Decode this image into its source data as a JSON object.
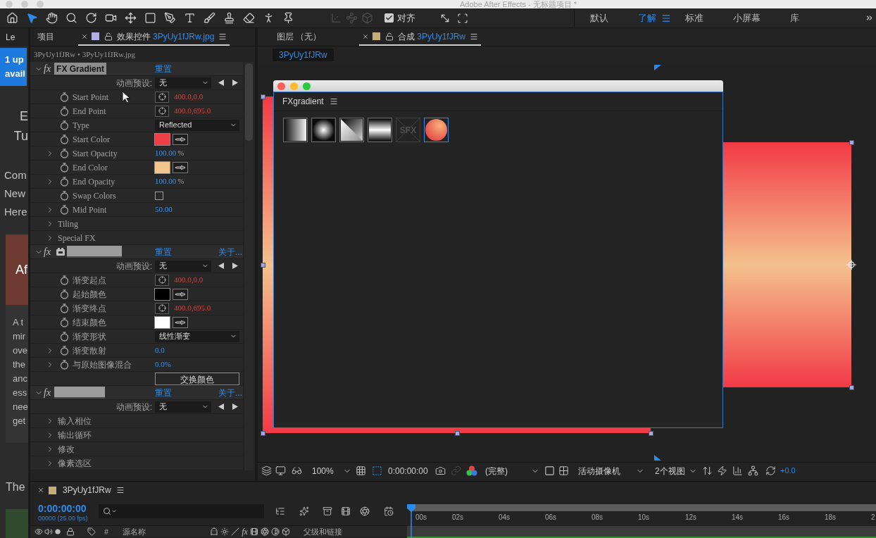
{
  "window": {
    "title": "Adobe After Effects - 无标题项目 *"
  },
  "toolbar": {
    "tool_groups": [
      [
        {
          "kind": "home",
          "selected": false,
          "disabled": false
        },
        {
          "kind": "select",
          "selected": true,
          "disabled": false
        },
        {
          "kind": "hand",
          "selected": false,
          "disabled": false
        },
        {
          "kind": "zoom",
          "selected": false,
          "disabled": false
        },
        {
          "kind": "rotate",
          "selected": false,
          "disabled": false
        },
        {
          "kind": "camera",
          "selected": false,
          "disabled": false
        },
        {
          "kind": "pan_behind",
          "selected": false,
          "disabled": false
        },
        {
          "kind": "rectangle",
          "selected": false,
          "disabled": false
        },
        {
          "kind": "pen",
          "selected": false,
          "disabled": false
        },
        {
          "kind": "type",
          "selected": false,
          "disabled": false
        },
        {
          "kind": "brush",
          "selected": false,
          "disabled": false
        },
        {
          "kind": "stamp",
          "selected": false,
          "disabled": false
        },
        {
          "kind": "eraser",
          "selected": false,
          "disabled": false
        },
        {
          "kind": "roto",
          "selected": false,
          "disabled": false
        },
        {
          "kind": "pin",
          "selected": false,
          "disabled": false
        }
      ],
      [
        {
          "kind": "axis_local",
          "selected": false,
          "disabled": true
        },
        {
          "kind": "axis_world",
          "selected": false,
          "disabled": true
        },
        {
          "kind": "axis_view",
          "selected": false,
          "disabled": true
        }
      ]
    ],
    "snapping": {
      "label": "对齐",
      "checked": true
    },
    "snap_options": [
      {
        "kind": "edges"
      },
      {
        "kind": "frame"
      }
    ]
  },
  "workspaces": [
    {
      "label": "默认",
      "selected": false
    },
    {
      "label": "了解",
      "selected": true
    },
    {
      "label": "标准",
      "selected": false
    },
    {
      "label": "小屏幕",
      "selected": false
    },
    {
      "label": "库",
      "selected": false
    }
  ],
  "background_window": {
    "tab": "Le",
    "notice": [
      "1 up",
      "avail"
    ],
    "heading": [
      "E",
      "Tu"
    ],
    "intro": [
      "Com",
      "New",
      "Here"
    ],
    "card": {
      "caption": "Af",
      "lines": [
        "A t",
        "mir",
        "ove",
        "the",
        "anc",
        "ess",
        "nee",
        "get"
      ]
    },
    "footer": "The"
  },
  "effects_panel": {
    "tabs": [
      {
        "label": "项目",
        "selected": false
      },
      {
        "label": "效果控件",
        "file": "3PyUy1fJRw.jpg",
        "color": "#b6b0e2",
        "selected": true
      }
    ],
    "breadcrumb": "3PyUy1fJRw • 3PyUy1fJRw.jpg",
    "effects": [
      {
        "kind": "titled",
        "name": "FX Gradient",
        "toggle": "fx",
        "expanded": true,
        "reset": "重置",
        "preset_label": "动画预设:",
        "preset": "无",
        "properties": [
          {
            "kind": "point",
            "label": "Start Point",
            "value": "400.0,0.0"
          },
          {
            "kind": "point",
            "label": "End Point",
            "value": "400.0,695.0"
          },
          {
            "kind": "dropdown",
            "label": "Type",
            "value": "Reflected"
          },
          {
            "kind": "color",
            "label": "Start Color",
            "color": "#ef3e45"
          },
          {
            "kind": "number",
            "label": "Start Opacity",
            "value": "100.00",
            "unit": "%",
            "expanded": false
          },
          {
            "kind": "color",
            "label": "End Color",
            "color": "#f2c58f"
          },
          {
            "kind": "number",
            "label": "End Opacity",
            "value": "100.00",
            "unit": "%",
            "expanded": false
          },
          {
            "kind": "checkbox",
            "label": "Swap Colors",
            "checked": false
          },
          {
            "kind": "number",
            "label": "Mid Point",
            "value": "50.00",
            "expanded": false
          },
          {
            "kind": "group",
            "label": "Tiling",
            "expanded": false
          },
          {
            "kind": "group",
            "label": "Special FX",
            "expanded": false
          }
        ]
      },
      {
        "kind": "badged",
        "toggle": "fx",
        "expanded": true,
        "reset": "重置",
        "about": "关于...",
        "preset_label": "动画预设:",
        "preset": "无",
        "properties": [
          {
            "kind": "point",
            "label": "渐变起点",
            "value": "400.0,0.0"
          },
          {
            "kind": "color",
            "label": "起始颜色",
            "color": "#000000"
          },
          {
            "kind": "point",
            "label": "渐变终点",
            "value": "400.0,695.0"
          },
          {
            "kind": "color",
            "label": "结束颜色",
            "color": "#ffffff"
          },
          {
            "kind": "dropdown",
            "label": "渐变形状",
            "value": "线性渐变"
          },
          {
            "kind": "number",
            "label": "渐变散射",
            "value": "0.0",
            "expanded": false
          },
          {
            "kind": "number",
            "label": "与原始图像混合",
            "value": "0.0%",
            "expanded": false
          },
          {
            "kind": "button",
            "label": "交换颜色"
          }
        ]
      },
      {
        "kind": "plain",
        "toggle": "fx",
        "expanded": true,
        "reset": "重置",
        "about": "关于...",
        "preset_label": "动画预设:",
        "preset": "无",
        "properties": [
          {
            "kind": "group",
            "label": "输入相位",
            "expanded": false
          },
          {
            "kind": "group",
            "label": "输出循环",
            "expanded": false
          },
          {
            "kind": "group",
            "label": "修改",
            "expanded": false
          },
          {
            "kind": "group",
            "label": "像素选区",
            "expanded": false
          }
        ]
      }
    ]
  },
  "composition_panel": {
    "tabs": [
      {
        "label": "图层 （无）",
        "selected": false
      },
      {
        "label": "合成",
        "file": "3PyUy1fJRw",
        "color": "#c6ac76",
        "selected": true
      }
    ],
    "view_tabs": [
      {
        "label": "3PyUy1fJRw",
        "selected": true
      }
    ],
    "plugin_window": {
      "panel_title": "FXgradient",
      "presets": [
        {
          "kind": "linear",
          "selected": false,
          "disabled": false
        },
        {
          "kind": "radial",
          "selected": false,
          "disabled": false
        },
        {
          "kind": "diagonal",
          "selected": false,
          "disabled": false
        },
        {
          "kind": "reflected",
          "selected": false,
          "disabled": false
        },
        {
          "kind": "sfx",
          "label": "SFX",
          "selected": false,
          "disabled": true
        },
        {
          "kind": "sphere",
          "selected": true,
          "disabled": false
        }
      ]
    },
    "viewer_bar": {
      "zoom": "100%",
      "timecode": "0:00:00:00",
      "resolution": "(完整)",
      "camera": "活动摄像机",
      "views": "2个视图",
      "exposure": "+0.0"
    }
  },
  "timeline": {
    "tab": {
      "label": "3PyUy1fJRw",
      "color": "#c6ac76"
    },
    "timecode": "0:00:00:00",
    "frame_info": "00000 (25.00 fps)",
    "ruler_labels": [
      "00s",
      "02s",
      "04s",
      "06s",
      "08s",
      "10s",
      "12s",
      "14s",
      "16s",
      "18s",
      "2"
    ],
    "columns": {
      "number": "#",
      "source_name": "源名称",
      "effects_column": "fx",
      "parent": "父级和链接"
    }
  }
}
